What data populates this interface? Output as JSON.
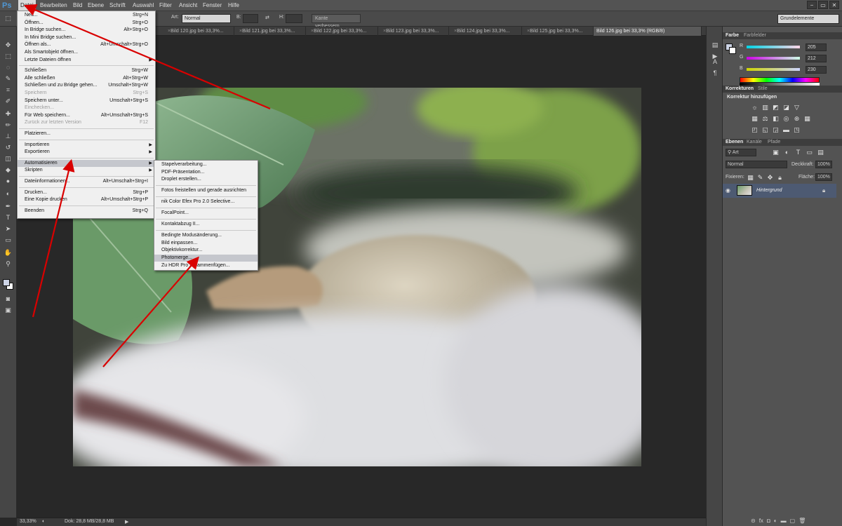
{
  "app": {
    "logo": "Ps"
  },
  "menubar": [
    {
      "label": "Datei",
      "active": true
    },
    {
      "label": "Bearbeiten"
    },
    {
      "label": "Bild"
    },
    {
      "label": "Ebene"
    },
    {
      "label": "Schrift"
    },
    {
      "label": "Auswahl"
    },
    {
      "label": "Filter"
    },
    {
      "label": "Ansicht"
    },
    {
      "label": "Fenster"
    },
    {
      "label": "Hilfe"
    }
  ],
  "window_controls": [
    "−",
    "▭",
    "✕"
  ],
  "options": {
    "art_label": "Art:",
    "art_value": "Normal",
    "b_label": "B:",
    "h_label": "H:",
    "refine_button": "Kante verbessern..."
  },
  "workspace": "Grundelemente",
  "tabs": [
    {
      "label": "Bild 120.jpg bei 33,3%..."
    },
    {
      "label": "Bild 121.jpg bei 33,3%..."
    },
    {
      "label": "Bild 122.jpg bei 33,3%..."
    },
    {
      "label": "Bild 123.jpg bei 33,3%..."
    },
    {
      "label": "Bild 124.jpg bei 33,3%..."
    },
    {
      "label": "Bild 125.jpg bei 33,3%..."
    },
    {
      "label": "Bild 126.jpg bei 33,3% (RGB/8)",
      "active": true
    }
  ],
  "status": {
    "zoom": "33,33%",
    "doc": "Dok: 28,8 MB/28,8 MB"
  },
  "color_panel": {
    "tabs": [
      "Farbe",
      "Farbfelder"
    ],
    "r": {
      "label": "R",
      "value": "205"
    },
    "g": {
      "label": "G",
      "value": "212"
    },
    "b": {
      "label": "B",
      "value": "230"
    },
    "foreground": "#cdd4e6"
  },
  "adjust_panel": {
    "tabs": [
      "Korrekturen",
      "Stile"
    ],
    "heading": "Korrektur hinzufügen"
  },
  "layers_panel": {
    "tabs": [
      "Ebenen",
      "Kanäle",
      "Pfade"
    ],
    "filter": "Art",
    "blend": "Normal",
    "opacity_label": "Deckkraft:",
    "opacity": "100%",
    "lock_label": "Fixieren:",
    "fill_label": "Fläche:",
    "fill": "100%",
    "layer_name": "Hintergrund"
  },
  "file_menu": [
    {
      "label": "Neu...",
      "sc": "Strg+N"
    },
    {
      "label": "Öffnen...",
      "sc": "Strg+O"
    },
    {
      "label": "In Bridge suchen...",
      "sc": "Alt+Strg+O"
    },
    {
      "label": "In Mini Bridge suchen...",
      "sc": ""
    },
    {
      "label": "Öffnen als...",
      "sc": "Alt+Umschalt+Strg+O"
    },
    {
      "label": "Als Smartobjekt öffnen...",
      "sc": ""
    },
    {
      "label": "Letzte Dateien öffnen",
      "sc": "",
      "sub": true
    },
    {
      "sep": true
    },
    {
      "label": "Schließen",
      "sc": "Strg+W"
    },
    {
      "label": "Alle schließen",
      "sc": "Alt+Strg+W"
    },
    {
      "label": "Schließen und zu Bridge gehen...",
      "sc": "Umschalt+Strg+W"
    },
    {
      "label": "Speichern",
      "sc": "Strg+S",
      "disabled": true
    },
    {
      "label": "Speichern unter...",
      "sc": "Umschalt+Strg+S"
    },
    {
      "label": "Einchecken...",
      "sc": "",
      "disabled": true
    },
    {
      "label": "Für Web speichern...",
      "sc": "Alt+Umschalt+Strg+S"
    },
    {
      "label": "Zurück zur letzten Version",
      "sc": "F12",
      "disabled": true
    },
    {
      "sep": true
    },
    {
      "label": "Platzieren...",
      "sc": ""
    },
    {
      "sep": true
    },
    {
      "label": "Importieren",
      "sc": "",
      "sub": true
    },
    {
      "label": "Exportieren",
      "sc": "",
      "sub": true
    },
    {
      "sep": true
    },
    {
      "label": "Automatisieren",
      "sc": "",
      "sub": true,
      "hl": true
    },
    {
      "label": "Skripten",
      "sc": "",
      "sub": true
    },
    {
      "sep": true
    },
    {
      "label": "Dateiinformationen...",
      "sc": "Alt+Umschalt+Strg+I"
    },
    {
      "sep": true
    },
    {
      "label": "Drucken...",
      "sc": "Strg+P"
    },
    {
      "label": "Eine Kopie drucken",
      "sc": "Alt+Umschalt+Strg+P"
    },
    {
      "sep": true
    },
    {
      "label": "Beenden",
      "sc": "Strg+Q"
    }
  ],
  "automate_menu": [
    {
      "label": "Stapelverarbeitung..."
    },
    {
      "label": "PDF-Präsentation..."
    },
    {
      "label": "Droplet erstellen..."
    },
    {
      "sep": true
    },
    {
      "label": "Fotos freistellen und gerade ausrichten"
    },
    {
      "sep": true
    },
    {
      "label": "nik Color Efex Pro 2.0 Selective..."
    },
    {
      "sep": true
    },
    {
      "label": "FocalPoint..."
    },
    {
      "sep": true
    },
    {
      "label": "Kontaktabzug II..."
    },
    {
      "sep": true
    },
    {
      "label": "Bedingte Modusänderung..."
    },
    {
      "label": "Bild einpassen..."
    },
    {
      "label": "Objektivkorrektur..."
    },
    {
      "label": "Photomerge...",
      "hl": true
    },
    {
      "label": "Zu HDR Pro zusammenfügen..."
    }
  ],
  "colors": {
    "annotation": "#d90000",
    "menu_bg": "#f0f0f0",
    "menu_highlight": "#c5c7cd",
    "layer_selected": "#4d5a72"
  }
}
